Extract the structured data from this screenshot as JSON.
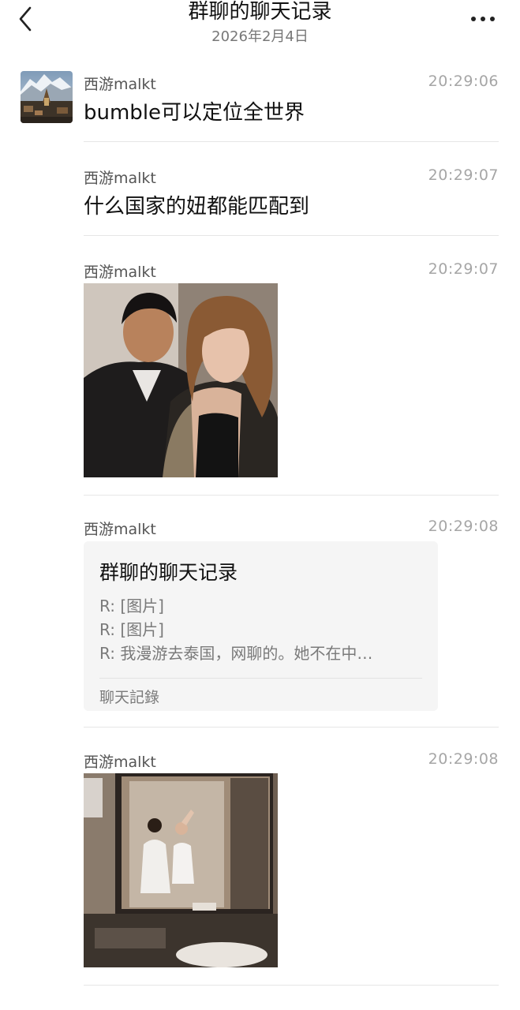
{
  "header": {
    "title": "群聊的聊天记录",
    "date": "2026年2月4日"
  },
  "messages": [
    {
      "sender": "西游malkt",
      "time": "20:29:06",
      "text": "bumble可以定位全世界"
    },
    {
      "sender": "西游malkt",
      "time": "20:29:07",
      "text": "什么国家的妞都能匹配到"
    },
    {
      "sender": "西游malkt",
      "time": "20:29:07",
      "type": "image"
    },
    {
      "sender": "西游malkt",
      "time": "20:29:08",
      "type": "chat-record",
      "card": {
        "title": "群聊的聊天记录",
        "lines": [
          "R: [图片]",
          "R: [图片]",
          "R: 我漫游去泰国，网聊的。她不在中…"
        ],
        "footer": "聊天記錄"
      }
    },
    {
      "sender": "西游malkt",
      "time": "20:29:08",
      "type": "image"
    }
  ],
  "icons": {
    "back": "chevron-left-icon",
    "more": "more-dots-icon"
  }
}
